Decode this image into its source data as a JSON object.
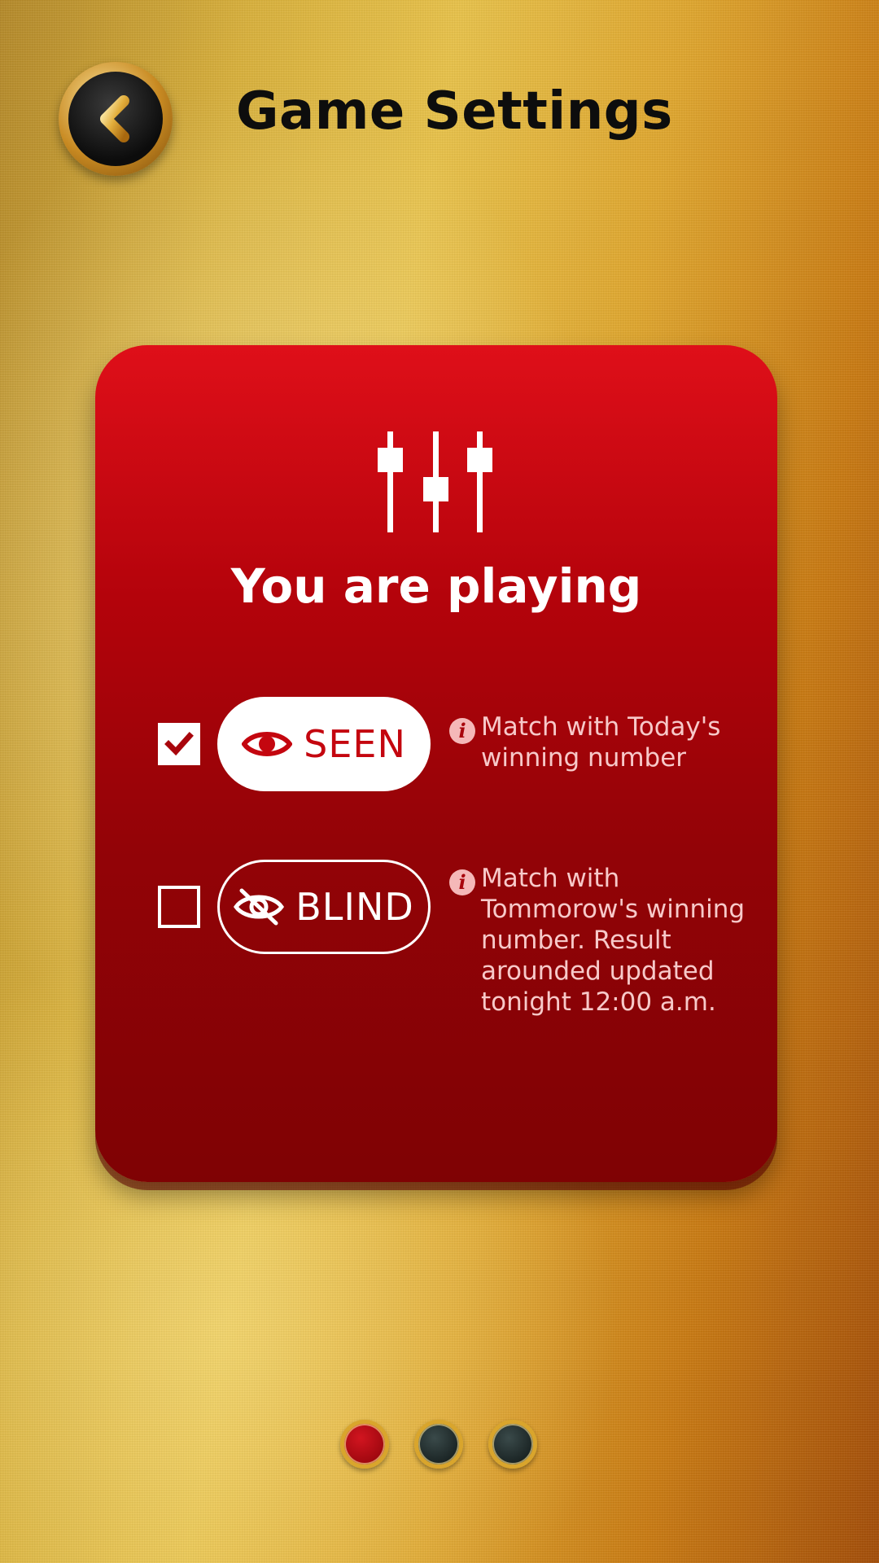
{
  "header": {
    "title": "Game Settings",
    "back_icon": "chevron-left-icon"
  },
  "card": {
    "icon": "equalizer-icon",
    "heading": "You are playing",
    "options": [
      {
        "id": "seen",
        "label": "SEEN",
        "icon": "eye-icon",
        "checked": true,
        "info": "Match with Today's winning number"
      },
      {
        "id": "blind",
        "label": "BLIND",
        "icon": "eye-off-icon",
        "checked": false,
        "info": "Match with Tommorow's winning number. Result arounded updated tonight 12:00 a.m."
      }
    ]
  },
  "pagination": {
    "pages": 3,
    "active_index": 0
  },
  "colors": {
    "card_red": "#c4060f",
    "gold": "#d9a52c",
    "title_black": "#0d0d0d"
  }
}
